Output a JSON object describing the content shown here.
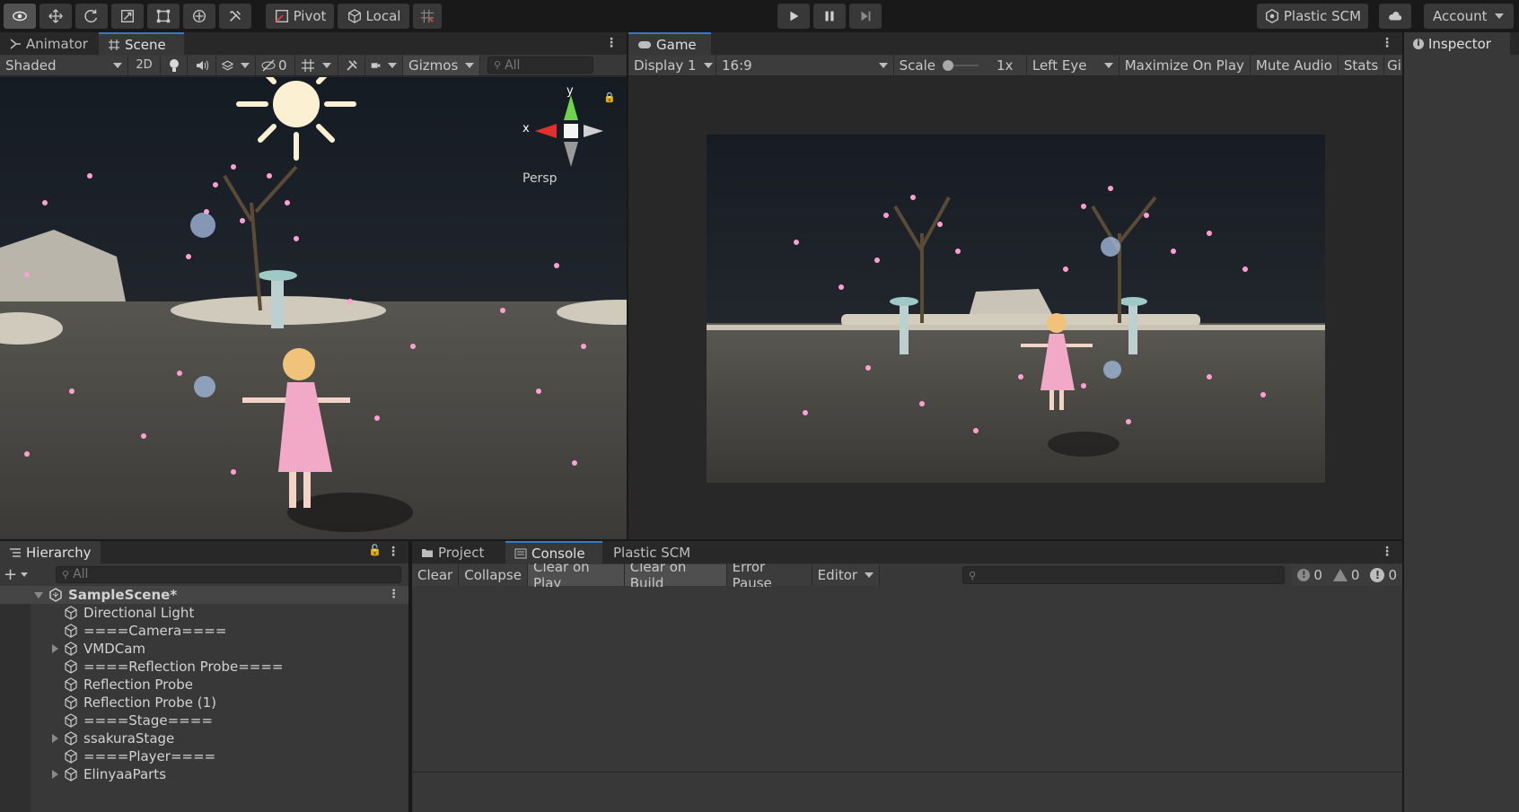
{
  "toolbar": {
    "pivot_label": "Pivot",
    "local_label": "Local",
    "plastic_label": "Plastic SCM",
    "account_label": "Account"
  },
  "scene_panel": {
    "tabs": [
      "Animator",
      "Scene"
    ],
    "shading_mode": "Shaded",
    "mode_2d": "2D",
    "hidden_count": "0",
    "gizmos_label": "Gizmos",
    "search_placeholder": "All",
    "persp_label": "Persp",
    "axis_x": "x",
    "axis_y": "y"
  },
  "game_panel": {
    "tab": "Game",
    "display": "Display 1",
    "aspect": "16:9",
    "scale_label": "Scale",
    "scale_value": "1x",
    "eye": "Left Eye",
    "maximize": "Maximize On Play",
    "mute": "Mute Audio",
    "stats": "Stats",
    "gizmos_cut": "Gi"
  },
  "inspector": {
    "tab": "Inspector"
  },
  "hierarchy": {
    "tab": "Hierarchy",
    "search_placeholder": "All",
    "scene_name": "SampleScene*",
    "items": [
      {
        "label": "Directional Light",
        "expandable": false
      },
      {
        "label": "====Camera====",
        "expandable": false
      },
      {
        "label": "VMDCam",
        "expandable": true
      },
      {
        "label": "====Reflection Probe====",
        "expandable": false
      },
      {
        "label": "Reflection Probe",
        "expandable": false
      },
      {
        "label": "Reflection Probe (1)",
        "expandable": false
      },
      {
        "label": "====Stage====",
        "expandable": false
      },
      {
        "label": "ssakuraStage",
        "expandable": true
      },
      {
        "label": "====Player====",
        "expandable": false
      },
      {
        "label": "ElinyaaParts",
        "expandable": true
      }
    ]
  },
  "console": {
    "tabs": [
      "Project",
      "Console",
      "Plastic SCM"
    ],
    "buttons": [
      "Clear",
      "Collapse",
      "Clear on Play",
      "Clear on Build",
      "Error Pause",
      "Editor"
    ],
    "info_count": "0",
    "warning_count": "0",
    "error_count": "0"
  }
}
